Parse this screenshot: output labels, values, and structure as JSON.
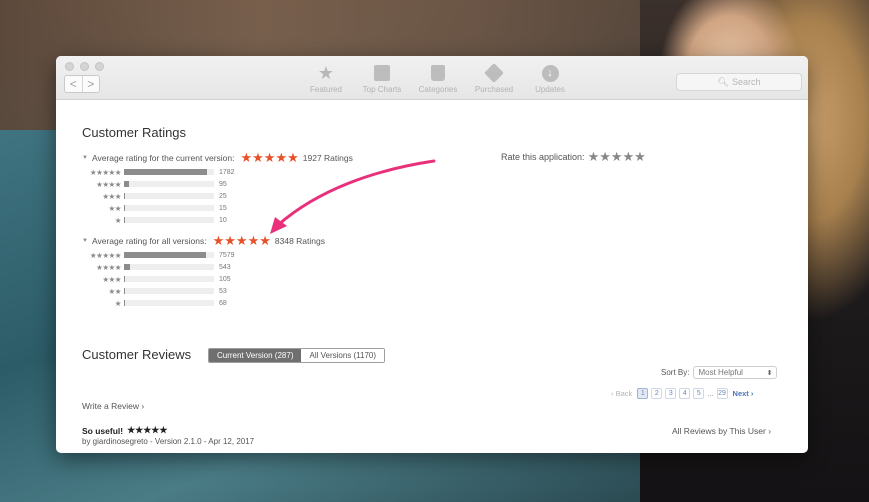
{
  "toolbar": {
    "back_label": "<",
    "forward_label": ">",
    "tabs": [
      {
        "label": "Featured",
        "icon": "star-icon"
      },
      {
        "label": "Top Charts",
        "icon": "top-charts-icon"
      },
      {
        "label": "Categories",
        "icon": "categories-icon"
      },
      {
        "label": "Purchased",
        "icon": "purchased-icon"
      },
      {
        "label": "Updates",
        "icon": "updates-icon"
      }
    ],
    "search_placeholder": "Search"
  },
  "ratings": {
    "title": "Customer Ratings",
    "current": {
      "label": "Average rating for the current version:",
      "stars": "★★★★★",
      "count": "1927 Ratings",
      "histogram": [
        {
          "stars": "★★★★★",
          "count": "1782",
          "fraction": 0.925
        },
        {
          "stars": "★★★★",
          "count": "95",
          "fraction": 0.05
        },
        {
          "stars": "★★★",
          "count": "25",
          "fraction": 0.013
        },
        {
          "stars": "★★",
          "count": "15",
          "fraction": 0.008
        },
        {
          "stars": "★",
          "count": "10",
          "fraction": 0.005
        }
      ]
    },
    "all": {
      "label": "Average rating for all versions:",
      "stars": "★★★★★",
      "count": "8348 Ratings",
      "histogram": [
        {
          "stars": "★★★★★",
          "count": "7579",
          "fraction": 0.908
        },
        {
          "stars": "★★★★",
          "count": "543",
          "fraction": 0.065
        },
        {
          "stars": "★★★",
          "count": "105",
          "fraction": 0.013
        },
        {
          "stars": "★★",
          "count": "53",
          "fraction": 0.006
        },
        {
          "stars": "★",
          "count": "68",
          "fraction": 0.008
        }
      ]
    },
    "rate_label": "Rate this application:",
    "rate_stars": "★★★★★"
  },
  "reviews": {
    "title": "Customer Reviews",
    "tab_current": "Current Version (287)",
    "tab_all": "All Versions (1170)",
    "sort_label": "Sort By:",
    "sort_value": "Most Helpful",
    "pager": {
      "back": "‹ Back",
      "pages": [
        "1",
        "2",
        "3",
        "4",
        "5"
      ],
      "ellipsis": "...",
      "last": "29",
      "next": "Next ›"
    },
    "write_review": "Write a Review ›",
    "first_review": {
      "title": "So useful!",
      "stars": "★★★★★",
      "meta": "by giardinosegreto - Version 2.1.0 - Apr 12, 2017"
    },
    "all_by_user": "All Reviews by This User ›"
  },
  "colors": {
    "star_accent": "#e8502a",
    "annotation_arrow": "#e8317a",
    "bar_fill": "#8c8c8c"
  }
}
